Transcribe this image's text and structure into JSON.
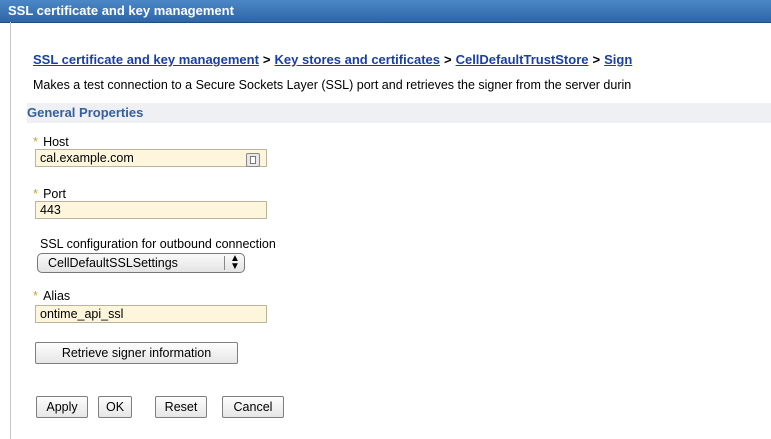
{
  "window": {
    "title": "SSL certificate and key management"
  },
  "breadcrumb": {
    "items": [
      "SSL certificate and key management",
      "Key stores and certificates",
      "CellDefaultTrustStore",
      "Sign"
    ],
    "separator": ">"
  },
  "description": "Makes a test connection to a Secure Sockets Layer (SSL) port and retrieves the signer from the server durin",
  "section": {
    "title": "General Properties"
  },
  "form": {
    "host": {
      "label": "Host",
      "value": "cal.example.com",
      "required_mark": "*"
    },
    "port": {
      "label": "Port",
      "value": "443",
      "required_mark": "*"
    },
    "ssl_config": {
      "label": "SSL configuration for outbound connection",
      "selected": "CellDefaultSSLSettings"
    },
    "alias": {
      "label": "Alias",
      "value": "ontime_api_ssl",
      "required_mark": "*"
    }
  },
  "buttons": {
    "retrieve": "Retrieve signer information",
    "apply": "Apply",
    "ok": "OK",
    "reset": "Reset",
    "cancel": "Cancel"
  },
  "colors": {
    "titlebar": "#2e66a8",
    "link": "#1a3f9e",
    "section_text": "#355f9c",
    "field_bg": "#fdf6dd",
    "required_star": "#c6a532"
  },
  "icons": {
    "host_field_icon": "address-book-icon",
    "select_arrow": "up-down-arrow-icon"
  }
}
